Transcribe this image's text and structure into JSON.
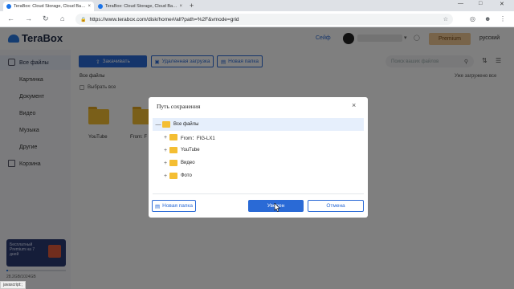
{
  "browser": {
    "tabs": [
      {
        "title": "TeraBox: Cloud Storage, Cloud Ba…",
        "close": "×"
      },
      {
        "title": "TeraBox: Cloud Storage, Cloud Ba…",
        "close": "×"
      }
    ],
    "new_tab": "+",
    "url": "https://www.terabox.com/disk/home#/all?path=%2F&vmode=grid"
  },
  "header": {
    "logo_text": "TeraBox",
    "link": "Сейф",
    "premium": "Premium",
    "language": "русский"
  },
  "sidebar": {
    "items": [
      {
        "label": "Все файлы"
      },
      {
        "label": "Картинка"
      },
      {
        "label": "Документ"
      },
      {
        "label": "Видео"
      },
      {
        "label": "Музыка"
      },
      {
        "label": "Другие"
      },
      {
        "label": "Корзина"
      }
    ],
    "promo_text": "Бесплатный Premium на 7 дней",
    "storage_text": "28.2GB/1024GB",
    "storage_fraction": 0.03,
    "status_hint": "javascript:;"
  },
  "toolbar": {
    "upload": "Закачивать",
    "remote_upload": "Удаленная загрузка",
    "new_folder": "Новая папка",
    "search_placeholder": "Поиск ваших файлов"
  },
  "main": {
    "breadcrumb": "Все файлы",
    "loaded_all": "Уже загружено все",
    "select_all": "Выбрать все",
    "folders": [
      {
        "label": "YouTube"
      },
      {
        "label": "From: F"
      }
    ]
  },
  "modal": {
    "title": "Путь сохранения",
    "close": "×",
    "tree": [
      {
        "label": "Все файлы",
        "toggle": "—"
      },
      {
        "label": "From：FIG-LX1",
        "toggle": "+"
      },
      {
        "label": "YouTube",
        "toggle": "+"
      },
      {
        "label": "Видео",
        "toggle": "+"
      },
      {
        "label": "Фото",
        "toggle": "+"
      }
    ],
    "new_folder": "Новая папка",
    "confirm": "Уверен",
    "cancel": "Отмена"
  },
  "colors": {
    "accent": "#2a6ad6",
    "folder": "#f4be33",
    "premium_bg": "#f0c894"
  }
}
